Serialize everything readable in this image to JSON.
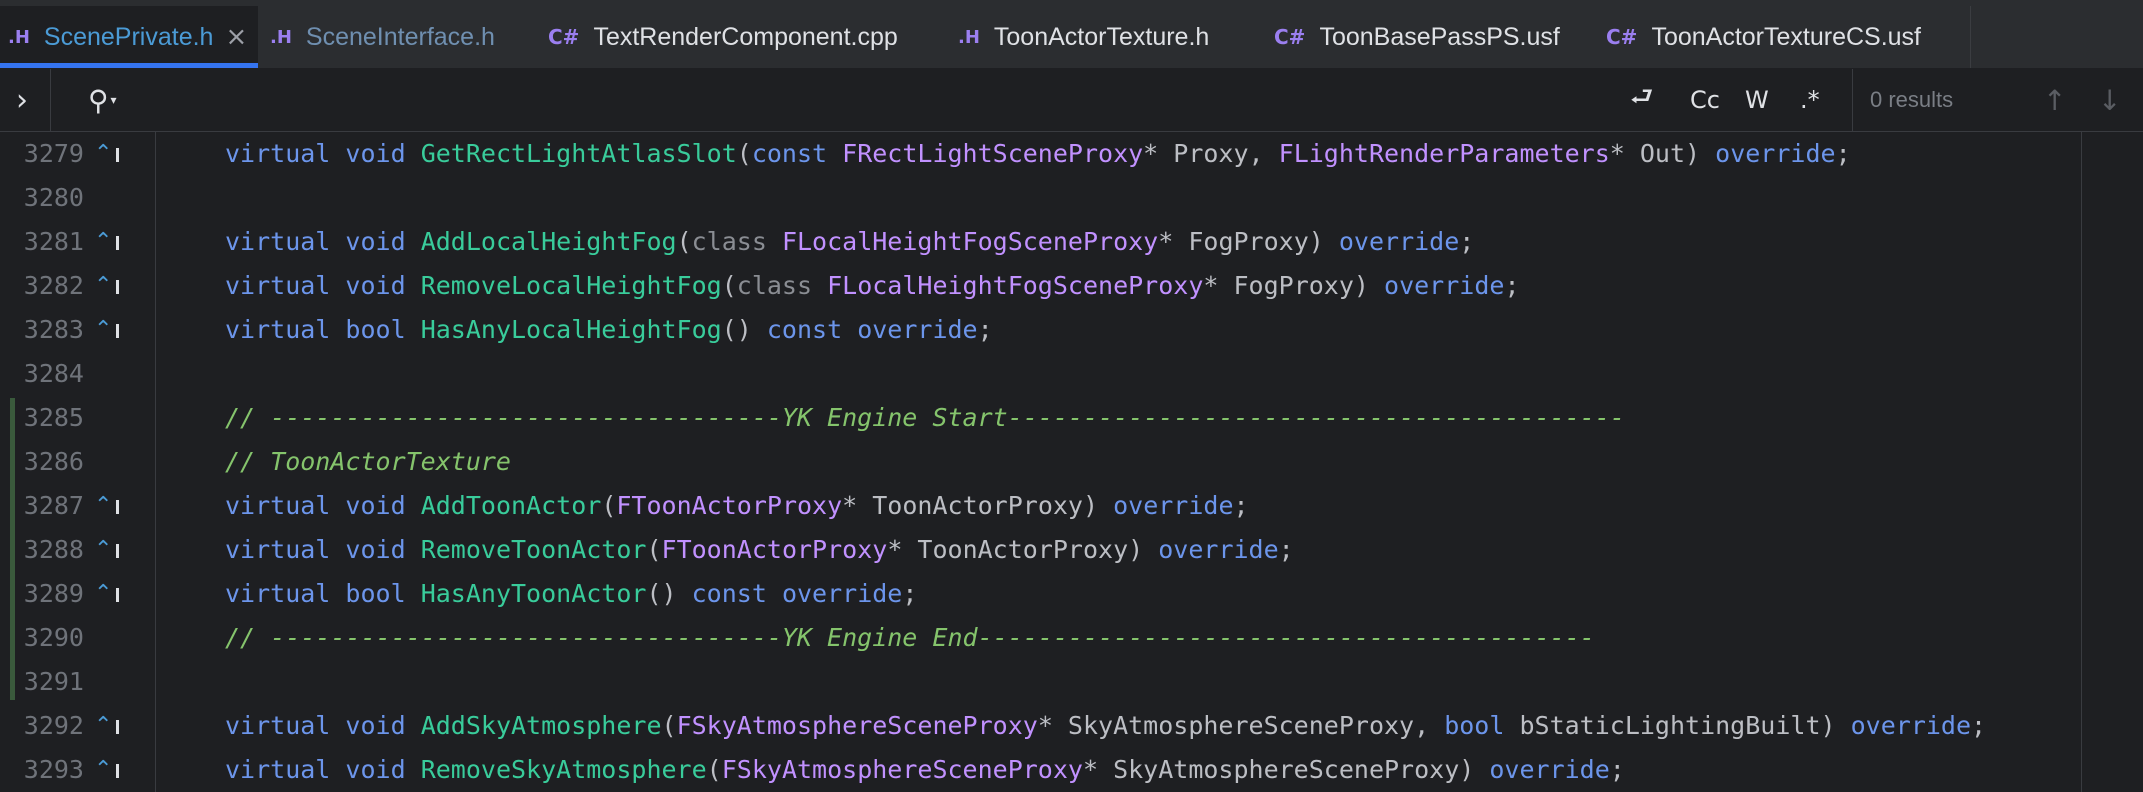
{
  "tabs": [
    {
      "icon": ".H",
      "label": "ScenePrivate.h",
      "active": true,
      "closable": true
    },
    {
      "icon": ".H",
      "label": "SceneInterface.h",
      "active": false
    },
    {
      "icon": "C#",
      "label": "TextRenderComponent.cpp",
      "active": false
    },
    {
      "icon": ".H",
      "label": "ToonActorTexture.h",
      "active": false
    },
    {
      "icon": "C#",
      "label": "ToonBasePassPS.usf",
      "active": false
    },
    {
      "icon": "C#",
      "label": "ToonActorTextureCS.usf",
      "active": false
    }
  ],
  "search": {
    "expand_icon": "›",
    "search_icon": "⚲",
    "options": {
      "preserve_case": "⮐",
      "match_case": "Cc",
      "words": "W",
      "regex": ".*"
    },
    "results": "0 results",
    "prev_icon": "↑",
    "next_icon": "↓"
  },
  "override_marker": "⌃",
  "lines": [
    {
      "n": "3279",
      "marker": true,
      "tokens": [
        [
          "kw",
          "virtual "
        ],
        [
          "kw",
          "void "
        ],
        [
          "fn",
          "GetRectLightAtlasSlot"
        ],
        [
          "plain",
          "("
        ],
        [
          "kw",
          "const "
        ],
        [
          "type",
          "FRectLightSceneProxy"
        ],
        [
          "plain",
          "* Proxy, "
        ],
        [
          "type",
          "FLightRenderParameters"
        ],
        [
          "plain",
          "* Out) "
        ],
        [
          "kw",
          "override"
        ],
        [
          "plain",
          ";"
        ]
      ]
    },
    {
      "n": "3280",
      "marker": false,
      "tokens": []
    },
    {
      "n": "3281",
      "marker": true,
      "tokens": [
        [
          "kw",
          "virtual "
        ],
        [
          "kw",
          "void "
        ],
        [
          "fn",
          "AddLocalHeightFog"
        ],
        [
          "plain",
          "("
        ],
        [
          "kwd",
          "class "
        ],
        [
          "type",
          "FLocalHeightFogSceneProxy"
        ],
        [
          "plain",
          "* FogProxy) "
        ],
        [
          "kw",
          "override"
        ],
        [
          "plain",
          ";"
        ]
      ]
    },
    {
      "n": "3282",
      "marker": true,
      "tokens": [
        [
          "kw",
          "virtual "
        ],
        [
          "kw",
          "void "
        ],
        [
          "fn",
          "RemoveLocalHeightFog"
        ],
        [
          "plain",
          "("
        ],
        [
          "kwd",
          "class "
        ],
        [
          "type",
          "FLocalHeightFogSceneProxy"
        ],
        [
          "plain",
          "* FogProxy) "
        ],
        [
          "kw",
          "override"
        ],
        [
          "plain",
          ";"
        ]
      ]
    },
    {
      "n": "3283",
      "marker": true,
      "tokens": [
        [
          "kw",
          "virtual "
        ],
        [
          "kw",
          "bool "
        ],
        [
          "fn",
          "HasAnyLocalHeightFog"
        ],
        [
          "plain",
          "() "
        ],
        [
          "kw",
          "const "
        ],
        [
          "kw",
          "override"
        ],
        [
          "plain",
          ";"
        ]
      ]
    },
    {
      "n": "3284",
      "marker": false,
      "tokens": []
    },
    {
      "n": "3285",
      "marker": false,
      "tokens": [
        [
          "comment",
          "// ----------------------------------YK Engine Start-----------------------------------------"
        ]
      ]
    },
    {
      "n": "3286",
      "marker": false,
      "tokens": [
        [
          "comment",
          "// ToonActorTexture"
        ]
      ]
    },
    {
      "n": "3287",
      "marker": true,
      "tokens": [
        [
          "kw",
          "virtual "
        ],
        [
          "kw",
          "void "
        ],
        [
          "fn",
          "AddToonActor"
        ],
        [
          "plain",
          "("
        ],
        [
          "type",
          "FToonActorProxy"
        ],
        [
          "plain",
          "* ToonActorProxy) "
        ],
        [
          "kw",
          "override"
        ],
        [
          "plain",
          ";"
        ]
      ]
    },
    {
      "n": "3288",
      "marker": true,
      "tokens": [
        [
          "kw",
          "virtual "
        ],
        [
          "kw",
          "void "
        ],
        [
          "fn",
          "RemoveToonActor"
        ],
        [
          "plain",
          "("
        ],
        [
          "type",
          "FToonActorProxy"
        ],
        [
          "plain",
          "* ToonActorProxy) "
        ],
        [
          "kw",
          "override"
        ],
        [
          "plain",
          ";"
        ]
      ]
    },
    {
      "n": "3289",
      "marker": true,
      "tokens": [
        [
          "kw",
          "virtual "
        ],
        [
          "kw",
          "bool "
        ],
        [
          "fn",
          "HasAnyToonActor"
        ],
        [
          "plain",
          "() "
        ],
        [
          "kw",
          "const "
        ],
        [
          "kw",
          "override"
        ],
        [
          "plain",
          ";"
        ]
      ]
    },
    {
      "n": "3290",
      "marker": false,
      "tokens": [
        [
          "comment",
          "// ----------------------------------YK Engine End-----------------------------------------"
        ]
      ]
    },
    {
      "n": "3291",
      "marker": false,
      "tokens": []
    },
    {
      "n": "3292",
      "marker": true,
      "tokens": [
        [
          "kw",
          "virtual "
        ],
        [
          "kw",
          "void "
        ],
        [
          "fn",
          "AddSkyAtmosphere"
        ],
        [
          "plain",
          "("
        ],
        [
          "type",
          "FSkyAtmosphereSceneProxy"
        ],
        [
          "plain",
          "* SkyAtmosphereSceneProxy, "
        ],
        [
          "kw",
          "bool "
        ],
        [
          "plain",
          "bStaticLightingBuilt) "
        ],
        [
          "kw",
          "override"
        ],
        [
          "plain",
          ";"
        ]
      ]
    },
    {
      "n": "3293",
      "marker": true,
      "tokens": [
        [
          "kw",
          "virtual "
        ],
        [
          "kw",
          "void "
        ],
        [
          "fn",
          "RemoveSkyAtmosphere"
        ],
        [
          "plain",
          "("
        ],
        [
          "type",
          "FSkyAtmosphereSceneProxy"
        ],
        [
          "plain",
          "* SkyAtmosphereSceneProxy) "
        ],
        [
          "kw",
          "override"
        ],
        [
          "plain",
          ";"
        ]
      ]
    }
  ]
}
